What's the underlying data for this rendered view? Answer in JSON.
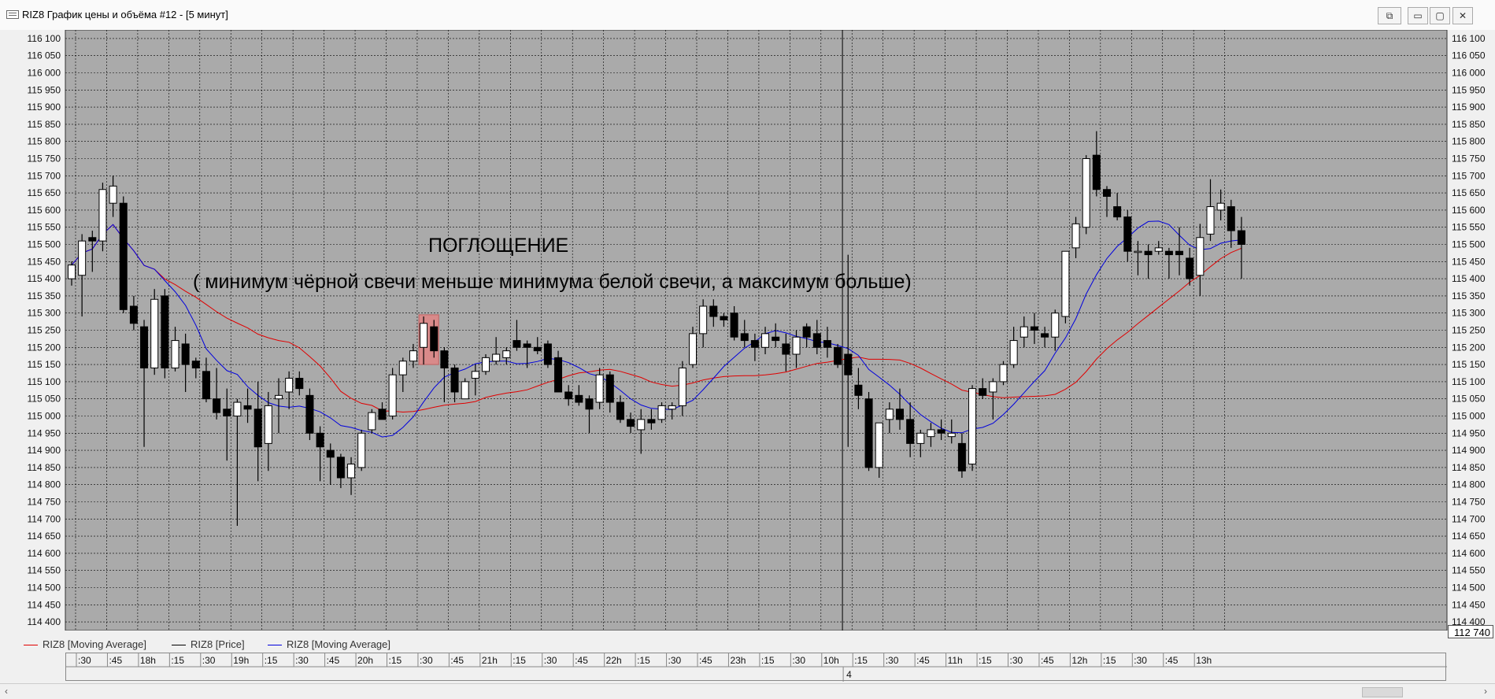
{
  "window": {
    "title": "RIZ8 График цены и объёма #12 - [5 минут]",
    "buttons": [
      "restore-icon",
      "minimize-icon",
      "maximize-icon",
      "close-icon"
    ]
  },
  "annotation": {
    "title": "ПОГЛОЩЕНИЕ",
    "text": "( минимум чёрной свечи меньше минимума белой свечи, а максимум больше)"
  },
  "legend": {
    "items": [
      {
        "label": "RIZ8 [Moving Average]",
        "color": "#e00000"
      },
      {
        "label": "RIZ8 [Price]",
        "color": "#000000"
      },
      {
        "label": "RIZ8 [Moving Average]",
        "color": "#0000dd"
      }
    ]
  },
  "last_price": "112 740",
  "colors": {
    "plot_bg": "#aaaaaa",
    "grid": "#000000",
    "bull": "#ffffff",
    "bear": "#000000",
    "highlight": "#d98a8a"
  },
  "chart_data": {
    "type": "candlestick",
    "title": "",
    "ylim": [
      114375,
      116125
    ],
    "yticks": [
      "116 100",
      "116 050",
      "116 000",
      "115 950",
      "115 900",
      "115 850",
      "115 800",
      "115 750",
      "115 700",
      "115 650",
      "115 600",
      "115 550",
      "115 500",
      "115 450",
      "115 400",
      "115 350",
      "115 300",
      "115 250",
      "115 200",
      "115 150",
      "115 100",
      "115 050",
      "115 000",
      "114 950",
      "114 900",
      "114 850",
      "114 800",
      "114 750",
      "114 700",
      "114 650",
      "114 600",
      "114 550",
      "114 500",
      "114 450",
      "114 400"
    ],
    "time_labels": [
      ":30",
      ":45",
      "18h",
      ":15",
      ":30",
      "19h",
      ":15",
      ":30",
      ":45",
      "20h",
      ":15",
      ":30",
      ":45",
      "21h",
      ":15",
      ":30",
      ":45",
      "22h",
      ":15",
      ":30",
      ":45",
      "23h",
      ":15",
      ":30",
      "10h",
      ":15",
      ":30",
      ":45",
      "11h",
      ":15",
      ":30",
      ":45",
      "12h",
      ":15",
      ":30",
      ":45",
      "13h"
    ],
    "date_label": "4",
    "candles": [
      [
        115400,
        115450,
        115380,
        115440
      ],
      [
        115410,
        115530,
        115290,
        115510
      ],
      [
        115520,
        115540,
        115420,
        115510
      ],
      [
        115510,
        115680,
        115480,
        115660
      ],
      [
        115620,
        115700,
        115580,
        115670
      ],
      [
        115620,
        115640,
        115300,
        115310
      ],
      [
        115320,
        115350,
        115250,
        115270
      ],
      [
        115260,
        115280,
        114910,
        115140
      ],
      [
        115140,
        115370,
        115120,
        115340
      ],
      [
        115350,
        115370,
        115110,
        115140
      ],
      [
        115140,
        115260,
        115130,
        115220
      ],
      [
        115210,
        115240,
        115070,
        115150
      ],
      [
        115160,
        115170,
        115110,
        115140
      ],
      [
        115130,
        115170,
        115040,
        115050
      ],
      [
        115050,
        115140,
        114990,
        115010
      ],
      [
        115020,
        115080,
        114870,
        115000
      ],
      [
        115000,
        115050,
        114680,
        115040
      ],
      [
        115030,
        115080,
        114980,
        115020
      ],
      [
        115020,
        115100,
        114810,
        114910
      ],
      [
        114920,
        115070,
        114840,
        115030
      ],
      [
        115050,
        115110,
        114950,
        115060
      ],
      [
        115070,
        115130,
        115020,
        115110
      ],
      [
        115110,
        115130,
        115060,
        115080
      ],
      [
        115060,
        115080,
        114930,
        114950
      ],
      [
        114950,
        114970,
        114810,
        114910
      ],
      [
        114900,
        114920,
        114800,
        114880
      ],
      [
        114880,
        114890,
        114790,
        114820
      ],
      [
        114820,
        114880,
        114770,
        114860
      ],
      [
        114850,
        114960,
        114840,
        114950
      ],
      [
        114960,
        115020,
        114950,
        115010
      ],
      [
        115020,
        115040,
        114990,
        114990
      ],
      [
        115000,
        115140,
        114990,
        115120
      ],
      [
        115120,
        115170,
        115070,
        115160
      ],
      [
        115160,
        115210,
        115140,
        115190
      ],
      [
        115200,
        115290,
        115150,
        115270
      ],
      [
        115260,
        115280,
        115170,
        115190
      ],
      [
        115190,
        115200,
        115040,
        115140
      ],
      [
        115140,
        115150,
        115040,
        115070
      ],
      [
        115050,
        115110,
        115050,
        115100
      ],
      [
        115110,
        115150,
        115060,
        115130
      ],
      [
        115130,
        115180,
        115120,
        115170
      ],
      [
        115160,
        115230,
        115150,
        115180
      ],
      [
        115170,
        115200,
        115150,
        115190
      ],
      [
        115220,
        115280,
        115190,
        115200
      ],
      [
        115210,
        115220,
        115140,
        115200
      ],
      [
        115200,
        115230,
        115180,
        115190
      ],
      [
        115210,
        115220,
        115140,
        115150
      ],
      [
        115170,
        115190,
        115070,
        115070
      ],
      [
        115070,
        115090,
        115030,
        115050
      ],
      [
        115060,
        115090,
        115030,
        115040
      ],
      [
        115050,
        115060,
        114950,
        115020
      ],
      [
        115040,
        115140,
        115020,
        115120
      ],
      [
        115120,
        115130,
        115010,
        115040
      ],
      [
        115040,
        115060,
        114980,
        114990
      ],
      [
        114990,
        115010,
        114950,
        114970
      ],
      [
        114960,
        115020,
        114890,
        114990
      ],
      [
        114990,
        115020,
        114960,
        114980
      ],
      [
        114990,
        115040,
        114980,
        115030
      ],
      [
        115020,
        115040,
        114990,
        115030
      ],
      [
        115030,
        115160,
        115000,
        115140
      ],
      [
        115150,
        115260,
        115140,
        115240
      ],
      [
        115240,
        115340,
        115200,
        115320
      ],
      [
        115320,
        115340,
        115260,
        115290
      ],
      [
        115290,
        115300,
        115260,
        115280
      ],
      [
        115300,
        115320,
        115220,
        115230
      ],
      [
        115240,
        115280,
        115200,
        115220
      ],
      [
        115220,
        115240,
        115160,
        115200
      ],
      [
        115200,
        115260,
        115180,
        115240
      ],
      [
        115230,
        115270,
        115200,
        115220
      ],
      [
        115210,
        115240,
        115130,
        115180
      ],
      [
        115180,
        115250,
        115140,
        115230
      ],
      [
        115260,
        115270,
        115200,
        115230
      ],
      [
        115240,
        115280,
        115180,
        115200
      ],
      [
        115220,
        115260,
        115170,
        115200
      ],
      [
        115200,
        115210,
        115140,
        115150
      ],
      [
        115180,
        115470,
        114910,
        115120
      ],
      [
        115090,
        115140,
        115020,
        115060
      ],
      [
        115050,
        115070,
        114840,
        114850
      ],
      [
        114850,
        114980,
        114820,
        114980
      ],
      [
        114990,
        115040,
        114950,
        115020
      ],
      [
        115020,
        115080,
        114960,
        114990
      ],
      [
        114990,
        115040,
        114880,
        114920
      ],
      [
        114920,
        114960,
        114880,
        114950
      ],
      [
        114940,
        114980,
        114910,
        114960
      ],
      [
        114960,
        114990,
        114930,
        114950
      ],
      [
        114940,
        114990,
        114920,
        114950
      ],
      [
        114920,
        114950,
        114820,
        114840
      ],
      [
        114860,
        115090,
        114840,
        115080
      ],
      [
        115080,
        115110,
        115050,
        115060
      ],
      [
        115070,
        115110,
        114990,
        115100
      ],
      [
        115100,
        115160,
        115090,
        115150
      ],
      [
        115150,
        115260,
        115140,
        115220
      ],
      [
        115230,
        115290,
        115200,
        115260
      ],
      [
        115260,
        115300,
        115210,
        115250
      ],
      [
        115240,
        115260,
        115200,
        115230
      ],
      [
        115230,
        115310,
        115190,
        115300
      ],
      [
        115290,
        115400,
        115270,
        115480
      ],
      [
        115490,
        115580,
        115460,
        115560
      ],
      [
        115550,
        115760,
        115530,
        115750
      ],
      [
        115760,
        115830,
        115640,
        115660
      ],
      [
        115660,
        115670,
        115580,
        115640
      ],
      [
        115610,
        115650,
        115570,
        115580
      ],
      [
        115580,
        115600,
        115450,
        115480
      ],
      [
        115480,
        115510,
        115410,
        115480
      ],
      [
        115480,
        115500,
        115400,
        115470
      ],
      [
        115480,
        115510,
        115470,
        115490
      ],
      [
        115480,
        115490,
        115400,
        115470
      ],
      [
        115480,
        115550,
        115410,
        115470
      ],
      [
        115460,
        115490,
        115380,
        115400
      ],
      [
        115410,
        115560,
        115350,
        115520
      ],
      [
        115530,
        115690,
        115510,
        115610
      ],
      [
        115600,
        115660,
        115570,
        115620
      ],
      [
        115610,
        115630,
        115490,
        115540
      ],
      [
        115540,
        115580,
        115400,
        115500
      ]
    ]
  }
}
